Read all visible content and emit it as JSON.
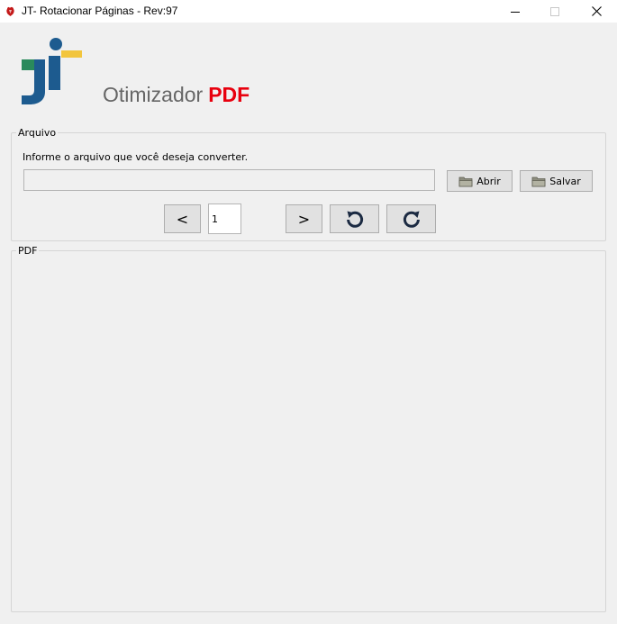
{
  "window": {
    "title": "JT- Rotacionar Páginas - Rev:97",
    "controls": [
      "minimize",
      "maximize",
      "close"
    ]
  },
  "branding": {
    "logo_icon": "jt-logo-icon",
    "app_name": "Otimizador",
    "app_name_highlight": "PDF",
    "highlight_color": "#e8000e"
  },
  "arquivo": {
    "group_label": "Arquivo",
    "instruction": "Informe o arquivo que você deseja converter.",
    "file_path": "",
    "open_label": "Abrir",
    "save_label": "Salvar",
    "prev_label": "<",
    "next_label": ">",
    "page": "1",
    "rotate_left_icon": "rotate-left-icon",
    "rotate_right_icon": "rotate-right-icon"
  },
  "pdf": {
    "group_label": "PDF"
  }
}
